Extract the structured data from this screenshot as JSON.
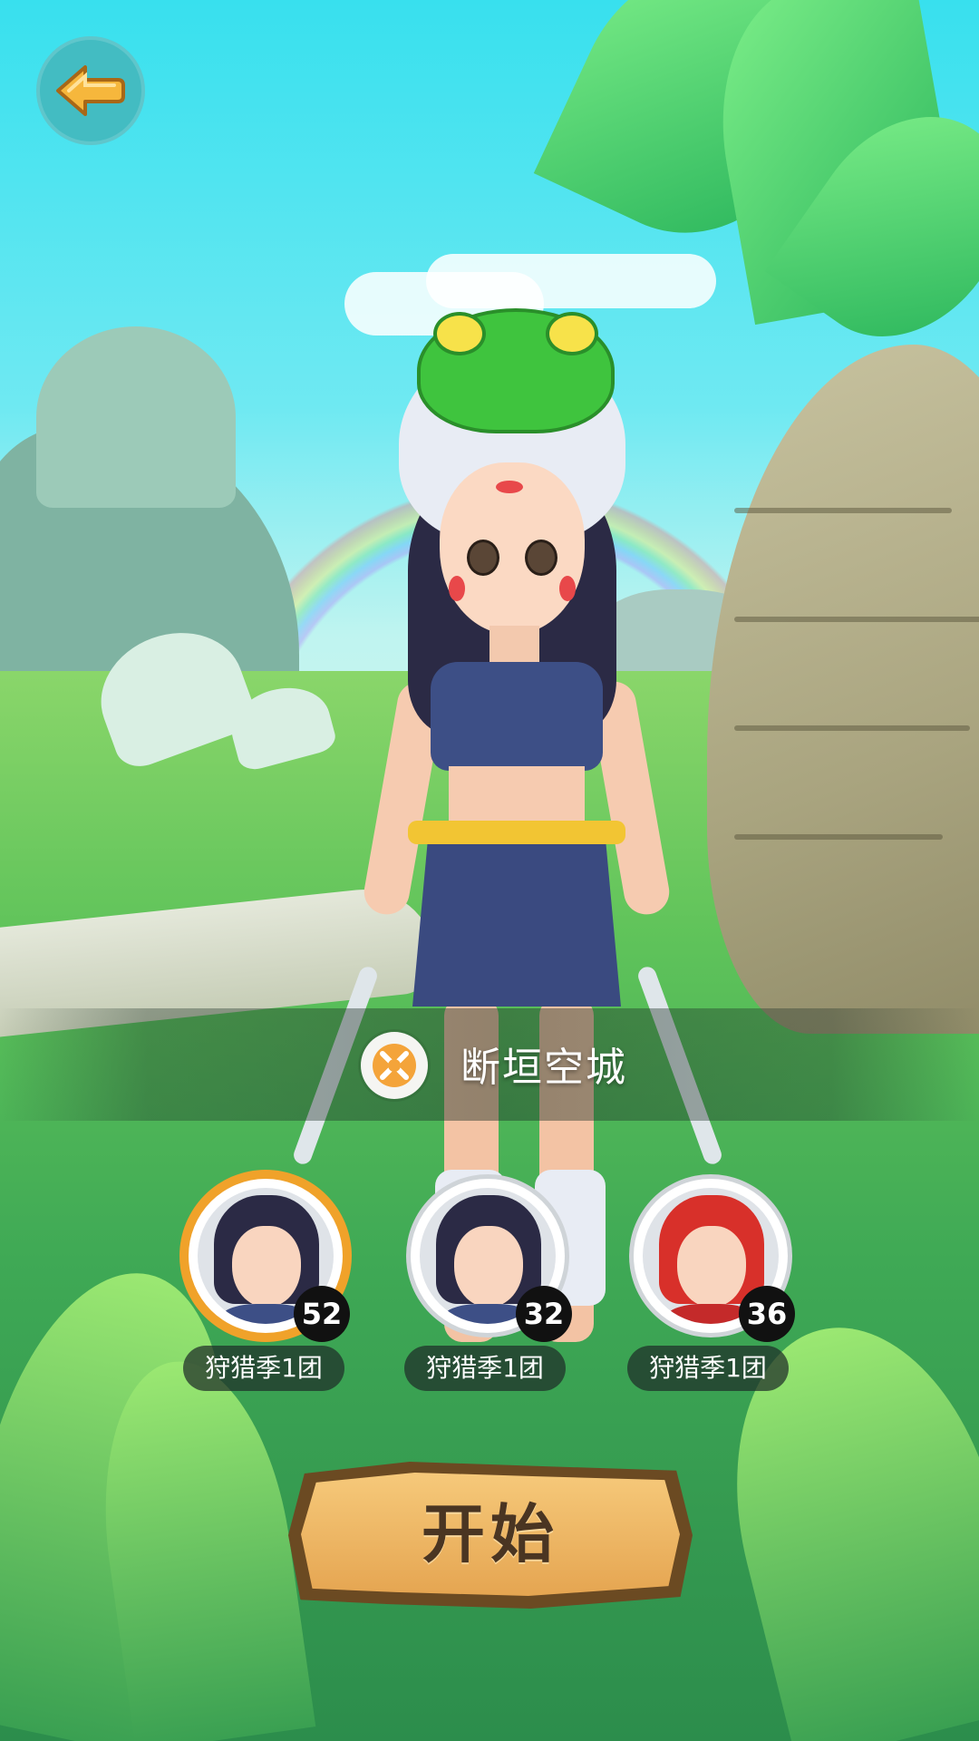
{
  "top_bar": {
    "back_icon": "left-arrow-icon",
    "back_color": "#43bcc2"
  },
  "map": {
    "icon": "crossed-swords-icon",
    "name": "断垣空城"
  },
  "party": [
    {
      "level": "52",
      "team": "狩猎季1团",
      "selected": true,
      "hair_color": "#2b2a45"
    },
    {
      "level": "32",
      "team": "狩猎季1团",
      "selected": false,
      "hair_color": "#2b2a45"
    },
    {
      "level": "36",
      "team": "狩猎季1团",
      "selected": false,
      "hair_color": "#d8302a"
    }
  ],
  "start_button": {
    "label": "开始"
  },
  "colors": {
    "selected_ring": "#f0a22a",
    "badge": "#111111",
    "start_text": "#4a3522"
  }
}
